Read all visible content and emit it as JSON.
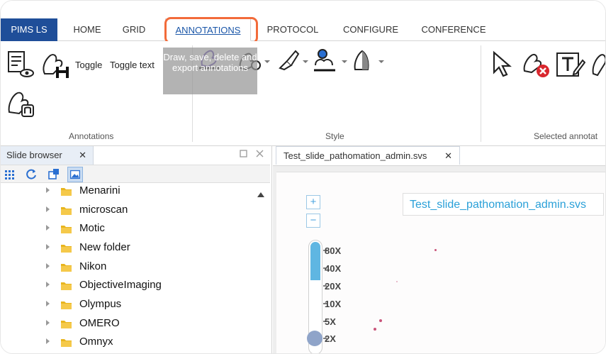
{
  "brand": "PIMS LS",
  "tabs": [
    {
      "label": "HOME"
    },
    {
      "label": "GRID"
    },
    {
      "label": "ANNOTATIONS"
    },
    {
      "label": "PROTOCOL"
    },
    {
      "label": "CONFIGURE"
    },
    {
      "label": "CONFERENCE"
    }
  ],
  "ribbon": {
    "toggle_label": "Toggle",
    "toggle_text_label": "Toggle text",
    "tooltip": "Draw, save, delete and export annotations",
    "groups": {
      "annotations": "Annotations",
      "style": "Style",
      "selected": "Selected annotat"
    },
    "icons": [
      "annotation-list-view-icon",
      "save-annotation-icon",
      "annotation-brush-icon",
      "pen-style-icon",
      "fill-style-icon",
      "brush-style-icon",
      "color-style-icon",
      "opacity-style-icon",
      "select-cursor-icon",
      "delete-annotation-icon",
      "edit-text-icon",
      "shape-style-icon"
    ]
  },
  "slide_browser": {
    "title": "Slide browser",
    "close": "✕",
    "toolbar_icons": [
      "grid-view-icon",
      "refresh-icon",
      "open-new-icon",
      "image-view-icon"
    ],
    "folders": [
      {
        "name": "Menarini"
      },
      {
        "name": "microscan"
      },
      {
        "name": "Motic"
      },
      {
        "name": "New folder"
      },
      {
        "name": "Nikon"
      },
      {
        "name": "ObjectiveImaging"
      },
      {
        "name": "Olympus"
      },
      {
        "name": "OMERO"
      },
      {
        "name": "Omnyx"
      }
    ]
  },
  "viewer": {
    "doc_tab": "Test_slide_pathomation_admin.svs",
    "close": "✕",
    "slide_title": "Test_slide_pathomation_admin.svs",
    "zoom_in": "+",
    "zoom_out": "−",
    "zoom_levels": [
      "80X",
      "40X",
      "20X",
      "10X",
      "5X",
      "2X"
    ],
    "zoom_level": "2X"
  },
  "colors": {
    "brand": "#1f4e99",
    "highlight": "#f26b3a",
    "accent_text": "#2aa0d8",
    "slider_fill": "#5fb6e2",
    "slider_knob": "#8fa4c9"
  }
}
